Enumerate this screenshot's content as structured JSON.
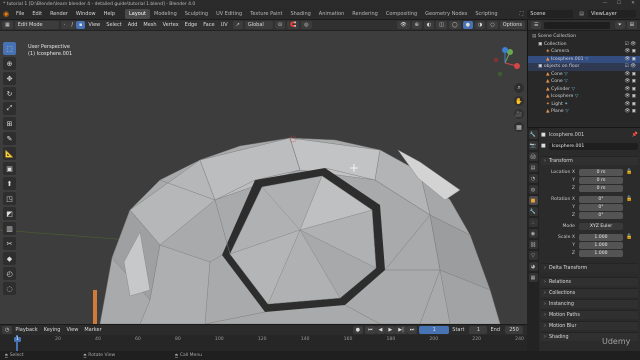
{
  "titlebar": {
    "title": "* tutorial 1 [D:\\Blender\\learn blender 4 - detailed guide\\tutorial 1.blend] - Blender 4.0",
    "minimize": "—",
    "maximize": "☐",
    "close": "✕"
  },
  "menu": [
    "File",
    "Edit",
    "Render",
    "Window",
    "Help"
  ],
  "workspaces": [
    "Layout",
    "Modeling",
    "Sculpting",
    "UV Editing",
    "Texture Paint",
    "Shading",
    "Animation",
    "Rendering",
    "Compositing",
    "Geometry Nodes",
    "Scripting"
  ],
  "active_workspace": "Layout",
  "scene": {
    "label": "Scene",
    "view_layer": "ViewLayer"
  },
  "viewport_header": {
    "mode": "Edit Mode",
    "menus": [
      "View",
      "Select",
      "Add",
      "Mesh",
      "Vertex",
      "Edge",
      "Face",
      "UV"
    ],
    "transform_orientation": "Global",
    "options": "Options"
  },
  "overlay": {
    "view_name": "User Perspective",
    "object_name": "(1) Icosphere.001"
  },
  "gizmo": {
    "x": "X",
    "y": "Y",
    "z": "Z"
  },
  "outliner": {
    "rows": [
      {
        "label": "Scene Collection",
        "indent": 0
      },
      {
        "label": "Collection",
        "indent": 1
      },
      {
        "label": "Camera",
        "indent": 2
      },
      {
        "label": "Icosphere.001",
        "indent": 2,
        "selected": true
      },
      {
        "label": "objects on floor",
        "indent": 1,
        "highlight": true
      },
      {
        "label": "Cone",
        "indent": 2
      },
      {
        "label": "Cone",
        "indent": 2
      },
      {
        "label": "Cylinder",
        "indent": 2
      },
      {
        "label": "Icosphere",
        "indent": 2
      },
      {
        "label": "Light",
        "indent": 2
      },
      {
        "label": "Plane",
        "indent": 2
      }
    ]
  },
  "properties": {
    "breadcrumb": "Icosphere.001",
    "object_name": "Icosphere.001",
    "transform": {
      "header": "Transform",
      "location_label": "Location X",
      "location": [
        "0 m",
        "0 m",
        "0 m"
      ],
      "rotation_label": "Rotation X",
      "rotation": [
        "0°",
        "0°",
        "0°"
      ],
      "mode_label": "Mode",
      "mode_value": "XYZ Euler",
      "scale_label": "Scale X",
      "scale": [
        "1.000",
        "1.000",
        "1.000"
      ],
      "axis_y": "Y",
      "axis_z": "Z"
    },
    "panels": [
      "Delta Transform",
      "Relations",
      "Collections",
      "Instancing",
      "Motion Paths",
      "Motion Blur",
      "Shading"
    ]
  },
  "timeline": {
    "menus": [
      "Playback",
      "Keying",
      "View",
      "Marker"
    ],
    "current_frame": "1",
    "start_label": "Start",
    "start": "1",
    "end_label": "End",
    "end": "250",
    "ticks": [
      "1",
      "20",
      "40",
      "60",
      "80",
      "100",
      "120",
      "140",
      "160",
      "180",
      "200",
      "220",
      "240"
    ]
  },
  "status": {
    "left": "Select",
    "middle": "Rotate View",
    "right": "Call Menu"
  },
  "watermark": "Udemy"
}
